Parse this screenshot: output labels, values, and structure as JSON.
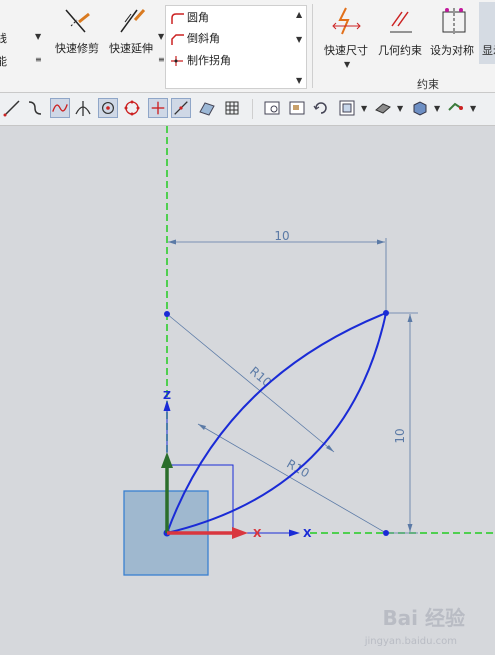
{
  "ribbon": {
    "left_partial_1": "线",
    "left_partial_2": "能",
    "quick_trim": "快速修剪",
    "quick_extend": "快速延伸",
    "list_items": [
      "圆角",
      "倒斜角",
      "制作拐角"
    ],
    "quick_dimension": "快速尺寸",
    "geometric_constraint": "几何约束",
    "set_symmetric": "设为对称",
    "show_partial": "显示",
    "group_constraints": "约束"
  },
  "canvas": {
    "dimension_top": "10",
    "dimension_right": "10",
    "radius_upper": "R10",
    "radius_lower": "R10",
    "axis_z": "Z",
    "axis_x_red": "X",
    "axis_x_blue": "X"
  },
  "watermark": {
    "brand": "Bai 经验",
    "url": "jingyan.baidu.com"
  },
  "colors": {
    "curve": "#1a2bd6",
    "dimension": "#5b7aa6",
    "reference_green": "#22cc22",
    "axis_z": "#2b6e2b",
    "axis_x": "#d9363e",
    "csys_fill": "#9fb8cf"
  }
}
